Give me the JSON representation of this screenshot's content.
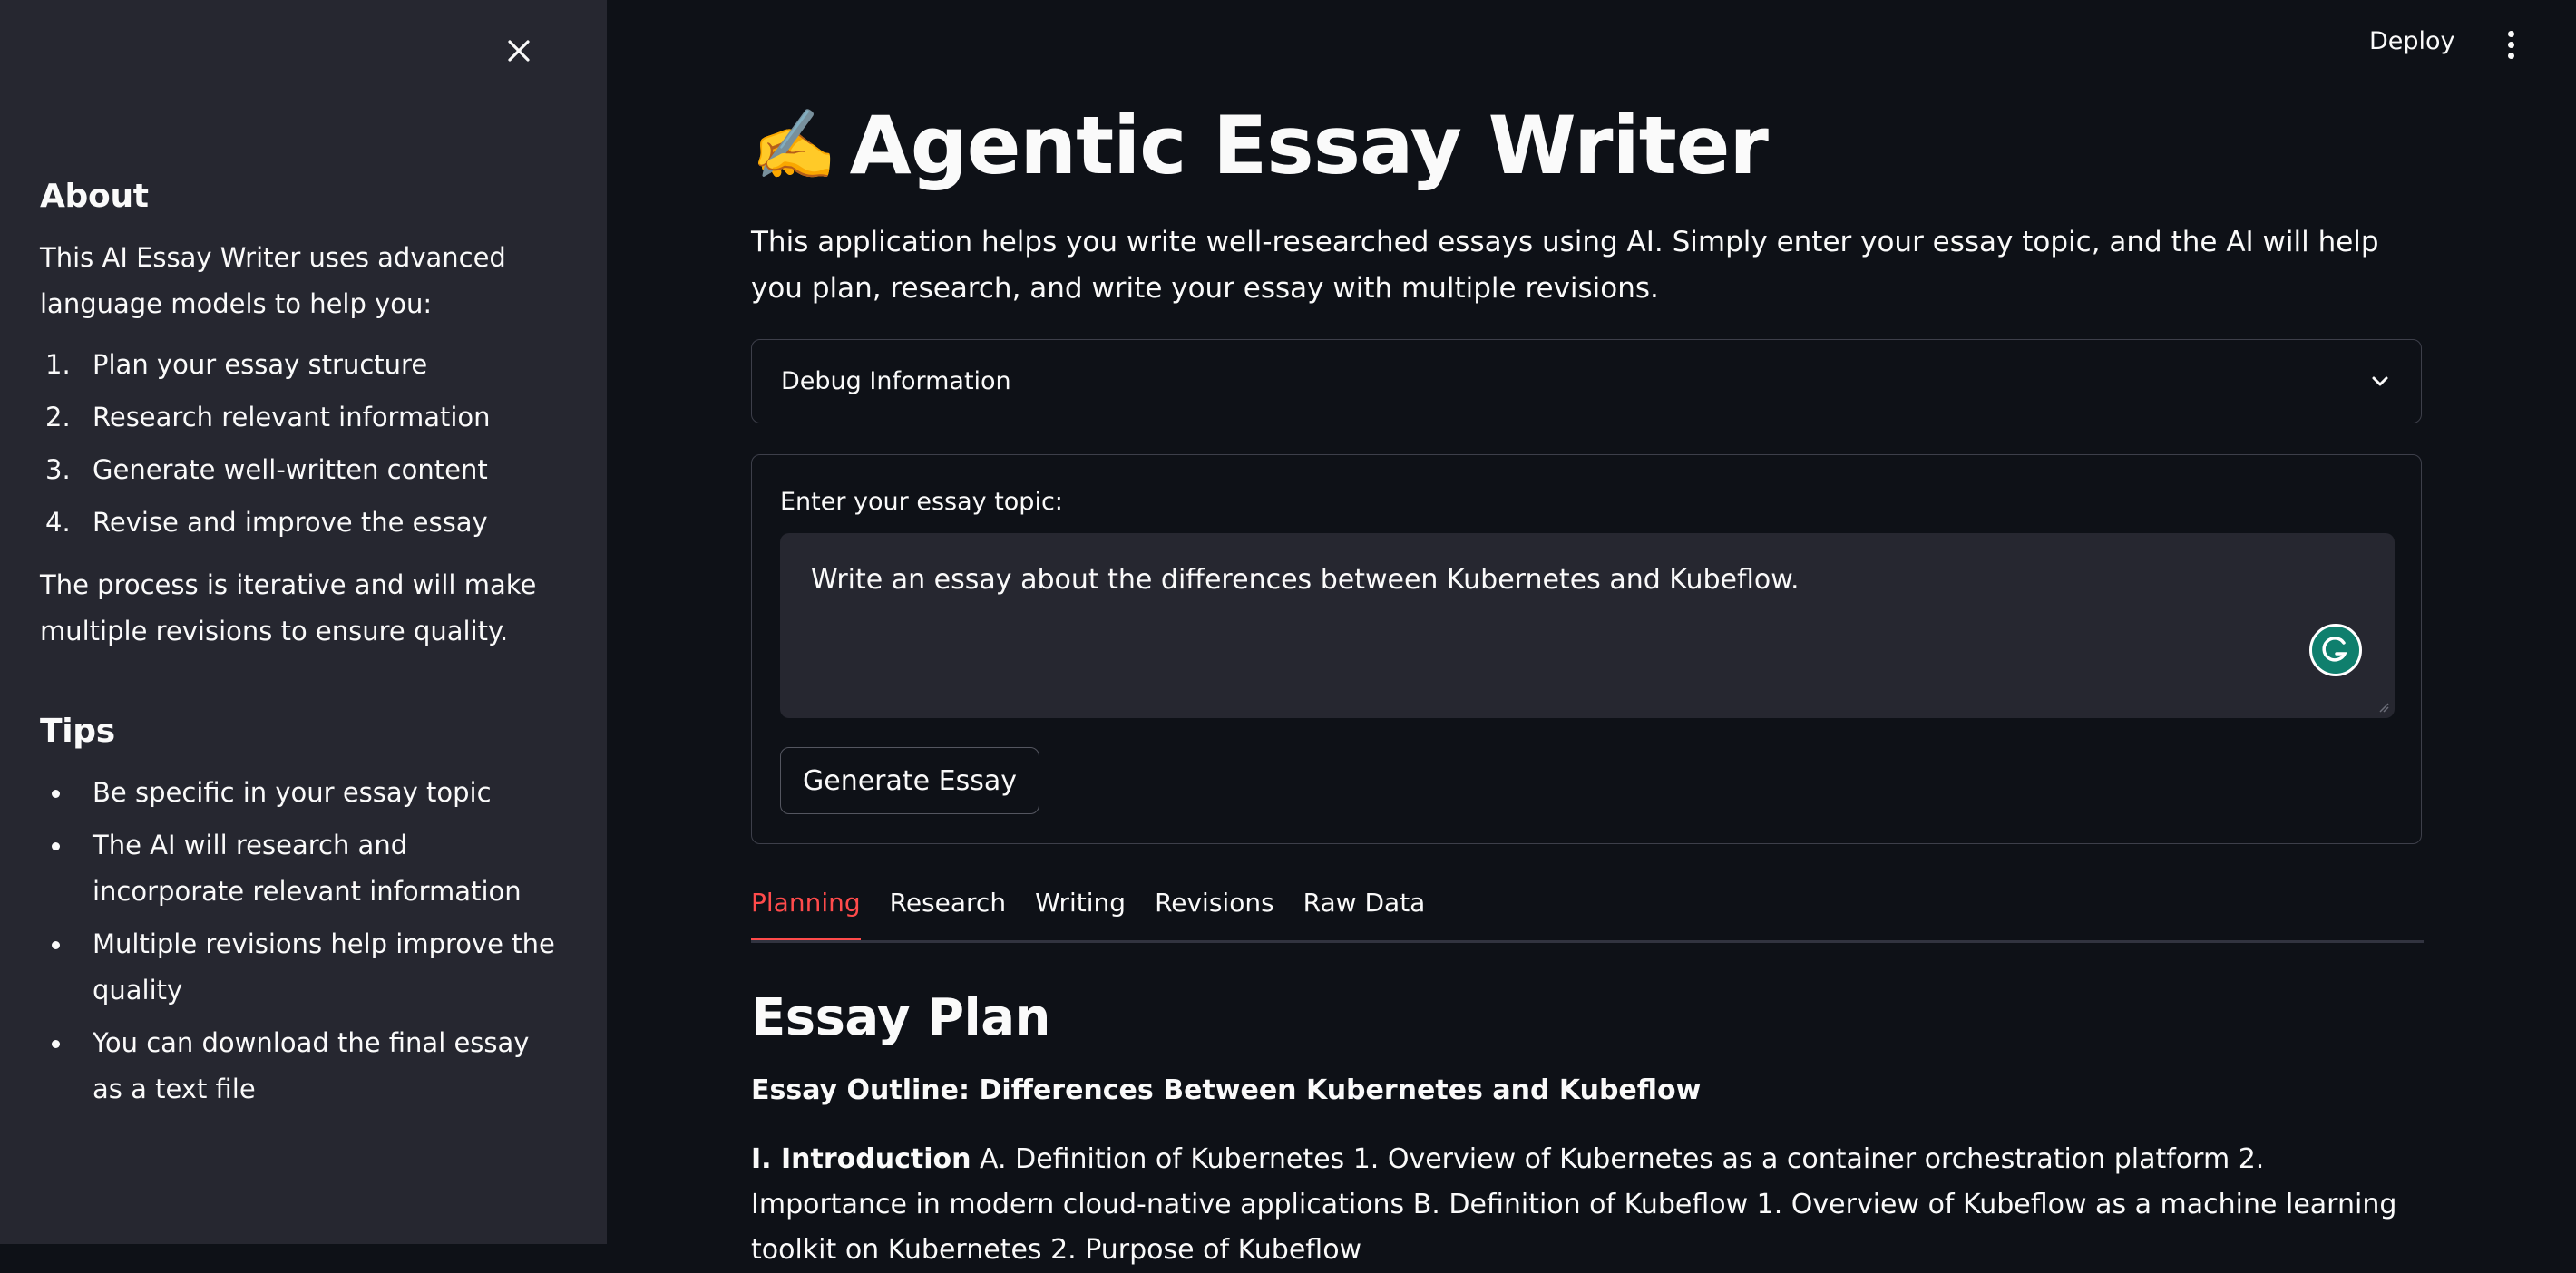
{
  "sidebar": {
    "about_heading": "About",
    "about_text": "This AI Essay Writer uses advanced language models to help you:",
    "steps": [
      {
        "num": "1.",
        "text": "Plan your essay structure"
      },
      {
        "num": "2.",
        "text": "Research relevant information"
      },
      {
        "num": "3.",
        "text": "Generate well-written content"
      },
      {
        "num": "4.",
        "text": "Revise and improve the essay"
      }
    ],
    "process_text": "The process is iterative and will make multiple revisions to ensure quality.",
    "tips_heading": "Tips",
    "tips": [
      "Be specific in your essay topic",
      "The AI will research and incorporate relevant information",
      "Multiple revisions help improve the quality",
      "You can download the final essay as a text file"
    ]
  },
  "header": {
    "deploy_label": "Deploy",
    "menu_icon": "kebab-menu-icon",
    "close_icon": "close-icon"
  },
  "main": {
    "title_emoji": "✍️",
    "title": "Agentic Essay Writer",
    "description": "This application helps you write well-researched essays using AI. Simply enter your essay topic, and the AI will help you plan, research, and write your essay with multiple revisions.",
    "debug_label": "Debug Information",
    "form": {
      "label": "Enter your essay topic:",
      "value": "Write an essay about the differences between Kubernetes and Kubeflow.",
      "button_label": "Generate Essay"
    },
    "tabs": [
      "Planning",
      "Research",
      "Writing",
      "Revisions",
      "Raw Data"
    ],
    "active_tab": "Planning",
    "essay_plan_heading": "Essay Plan",
    "outline_title": "Essay Outline: Differences Between Kubernetes and Kubeflow",
    "outline_intro_bold": "I. Introduction",
    "outline_intro_text": " A. Definition of Kubernetes 1. Overview of Kubernetes as a container orchestration platform 2. Importance in modern cloud-native applications B. Definition of Kubeflow 1. Overview of Kubeflow as a machine learning toolkit on Kubernetes 2. Purpose of Kubeflow"
  },
  "colors": {
    "background": "#0e1117",
    "sidebar": "#262730",
    "accent": "#ff4b4b",
    "text": "#fafafa"
  }
}
